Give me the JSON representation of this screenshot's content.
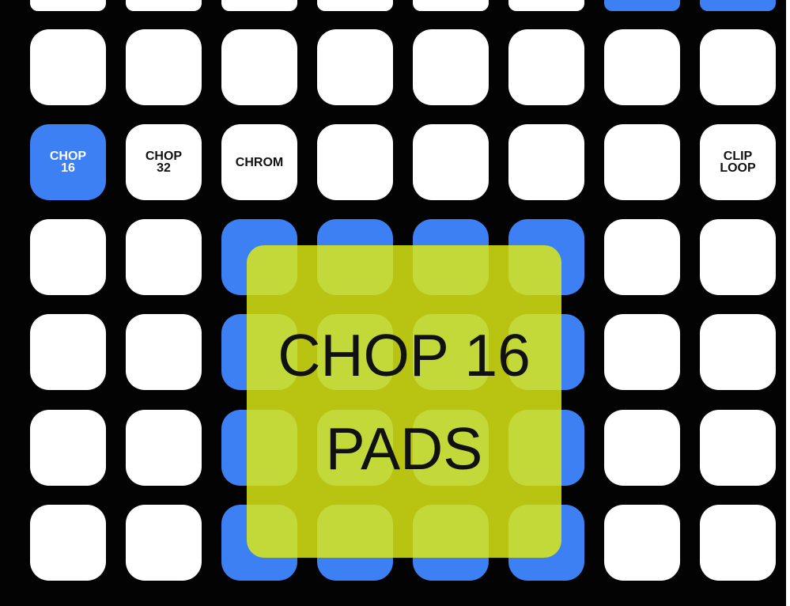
{
  "colors": {
    "background": "#030303",
    "pad_off": "#ffffff",
    "pad_on": "#3d80f4",
    "overlay": "#dce814"
  },
  "top_row": [
    {
      "on": false
    },
    {
      "on": false
    },
    {
      "on": false
    },
    {
      "on": false
    },
    {
      "on": false
    },
    {
      "on": false
    },
    {
      "on": true
    },
    {
      "on": true
    }
  ],
  "grid": [
    [
      {
        "label": "",
        "on": false
      },
      {
        "label": "",
        "on": false
      },
      {
        "label": "",
        "on": false
      },
      {
        "label": "",
        "on": false
      },
      {
        "label": "",
        "on": false
      },
      {
        "label": "",
        "on": false
      },
      {
        "label": "",
        "on": false
      },
      {
        "label": "",
        "on": false
      }
    ],
    [
      {
        "label": "CHOP\n16",
        "on": true
      },
      {
        "label": "CHOP\n32",
        "on": false
      },
      {
        "label": "CHROM",
        "on": false
      },
      {
        "label": "",
        "on": false
      },
      {
        "label": "",
        "on": false
      },
      {
        "label": "",
        "on": false
      },
      {
        "label": "",
        "on": false
      },
      {
        "label": "CLIP\nLOOP",
        "on": false
      }
    ],
    [
      {
        "label": "",
        "on": false
      },
      {
        "label": "",
        "on": false
      },
      {
        "label": "",
        "on": true
      },
      {
        "label": "",
        "on": true
      },
      {
        "label": "",
        "on": true
      },
      {
        "label": "",
        "on": true
      },
      {
        "label": "",
        "on": false
      },
      {
        "label": "",
        "on": false
      }
    ],
    [
      {
        "label": "",
        "on": false
      },
      {
        "label": "",
        "on": false
      },
      {
        "label": "",
        "on": true
      },
      {
        "label": "",
        "on": true
      },
      {
        "label": "",
        "on": true
      },
      {
        "label": "",
        "on": true
      },
      {
        "label": "",
        "on": false
      },
      {
        "label": "",
        "on": false
      }
    ],
    [
      {
        "label": "",
        "on": false
      },
      {
        "label": "",
        "on": false
      },
      {
        "label": "",
        "on": true
      },
      {
        "label": "",
        "on": true
      },
      {
        "label": "",
        "on": true
      },
      {
        "label": "",
        "on": true
      },
      {
        "label": "",
        "on": false
      },
      {
        "label": "",
        "on": false
      }
    ],
    [
      {
        "label": "",
        "on": false
      },
      {
        "label": "",
        "on": false
      },
      {
        "label": "",
        "on": true
      },
      {
        "label": "",
        "on": true
      },
      {
        "label": "",
        "on": true
      },
      {
        "label": "",
        "on": true
      },
      {
        "label": "",
        "on": false
      },
      {
        "label": "",
        "on": false
      }
    ]
  ],
  "overlay": {
    "line1": "CHOP 16",
    "line2": "PADS"
  }
}
